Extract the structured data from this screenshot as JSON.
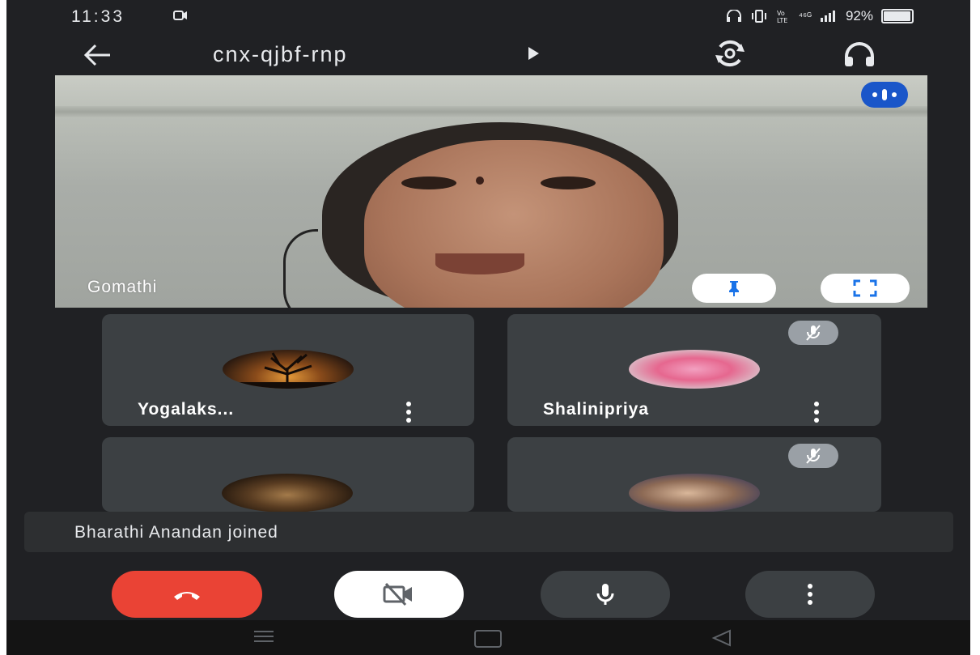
{
  "status_bar": {
    "time": "11:33",
    "right_text": "⁴⁶ᴳ",
    "battery_percent": "92%",
    "battery_level": 0.92,
    "icons": [
      "video-recording-icon",
      "headphones-icon",
      "vibrate-icon",
      "volte-icon",
      "signal-icon",
      "battery-icon"
    ]
  },
  "top_bar": {
    "meeting_code": "cnx-qjbf-rnp",
    "icons": [
      "back-arrow-icon",
      "play-icon",
      "switch-camera-icon",
      "headphones-icon"
    ]
  },
  "main_video": {
    "speaker_name": "Gomathi",
    "icons": [
      "more-options-pill-icon",
      "pin-icon",
      "fullscreen-icon"
    ]
  },
  "participants": [
    {
      "name": "Yogalaks...",
      "muted": false
    },
    {
      "name": "Shalinipriya",
      "muted": true
    },
    {
      "name": "",
      "muted": false
    },
    {
      "name": "",
      "muted": true
    }
  ],
  "toast": {
    "text": "Bharathi Anandan joined"
  },
  "controls": {
    "icons": [
      "end-call-icon",
      "camera-off-icon",
      "microphone-icon",
      "more-vert-icon"
    ],
    "colors": {
      "end_call": "#ea4335",
      "camera": "#ffffff",
      "mic": "#3c4043",
      "more": "#3c4043"
    }
  },
  "theme": {
    "background": "#202124",
    "tile": "#3c4043",
    "accent_blue": "#1a56c9"
  }
}
